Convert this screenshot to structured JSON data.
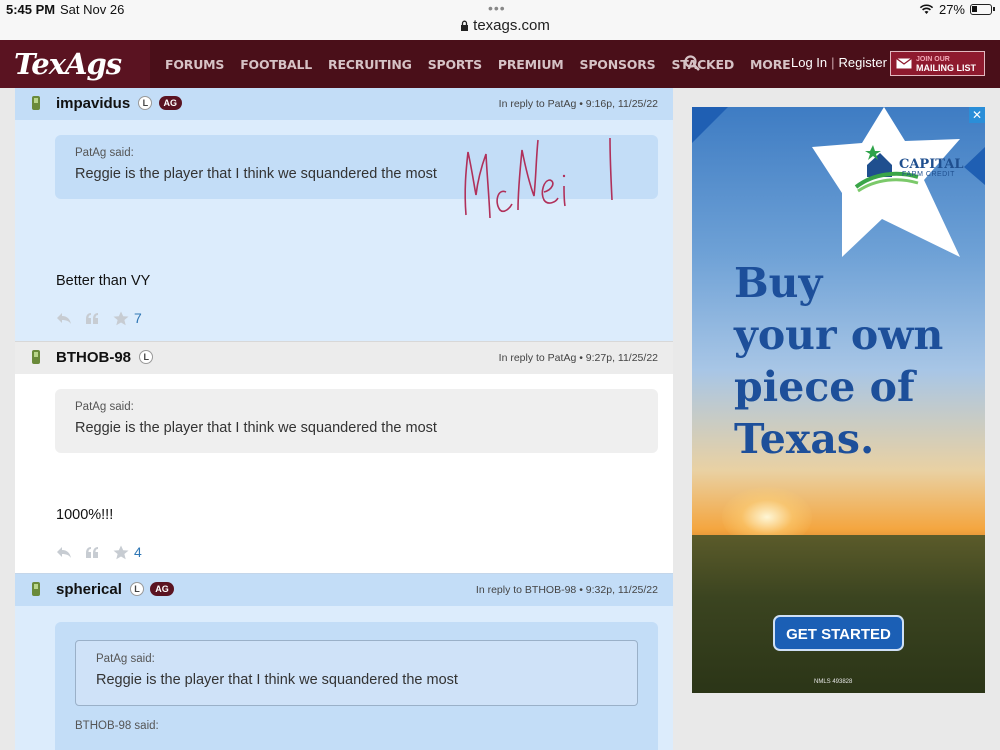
{
  "status": {
    "time": "5:45 PM",
    "date": "Sat Nov 26",
    "url": "texags.com",
    "battery": "27%"
  },
  "nav": {
    "logo": "TexAgs",
    "items": [
      "FORUMS",
      "FOOTBALL",
      "RECRUITING",
      "SPORTS",
      "PREMIUM",
      "SPONSORS",
      "STACKED",
      "MORE"
    ],
    "login": "Log In",
    "separator": "|",
    "register": "Register",
    "mailing_top": "JOIN OUR",
    "mailing_bottom": "MAILING LIST"
  },
  "posts": [
    {
      "username": "impavidus",
      "badge_l": "L",
      "badge_ag": "AG",
      "meta": "In reply to PatAg • 9:16p, 11/25/22",
      "quote_said": "PatAg said:",
      "quote_text": "Reggie is the player that I think we squandered the most",
      "text": "Better than VY",
      "stars": "7",
      "handwriting": "McNeil"
    },
    {
      "username": "BTHOB-98",
      "badge_l": "L",
      "meta": "In reply to PatAg • 9:27p, 11/25/22",
      "quote_said": "PatAg said:",
      "quote_text": "Reggie is the player that I think we squandered the most",
      "text": "1000%!!!",
      "stars": "4"
    },
    {
      "username": "spherical",
      "badge_l": "L",
      "badge_ag": "AG",
      "meta": "In reply to BTHOB-98 • 9:32p, 11/25/22",
      "nested_said": "PatAg said:",
      "nested_text": "Reggie is the player that I think we squandered the most",
      "quote_said": "BTHOB-98 said:"
    }
  ],
  "ad": {
    "brand_line1": "CAPITAL",
    "brand_line2": "FARM CREDIT",
    "headline_lines": [
      "Buy",
      "your own",
      "piece of",
      "Texas."
    ],
    "cta": "GET STARTED",
    "legal": "NMLS 493828",
    "close": "✕"
  },
  "colors": {
    "nav_bg": "#4a0f19",
    "post_blue": "#dcecfc",
    "ad_blue": "#1d4f9a"
  }
}
